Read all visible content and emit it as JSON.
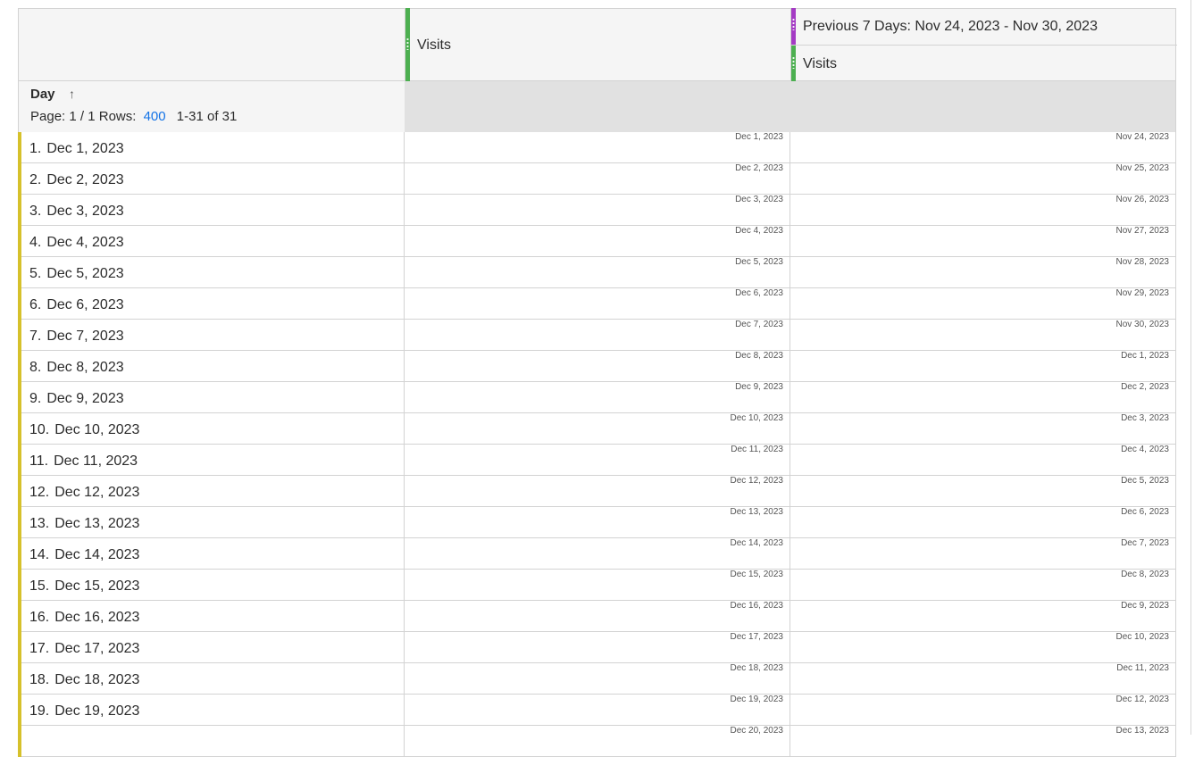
{
  "header": {
    "col1_metric": "Visits",
    "col2_segment": "Previous 7 Days: Nov 24, 2023 - Nov 30, 2023",
    "col2_metric": "Visits",
    "colors": {
      "visits_grip": "#4caf50",
      "segment_grip": "#a43bc4",
      "row_bar": "#d6c12b",
      "link": "#1473e6"
    }
  },
  "dimension": {
    "title": "Day",
    "sort_icon": "arrow-up-icon",
    "pager_label": "Page: 1 / 1",
    "rows_label": "Rows:",
    "rows_value": "400",
    "range_label": "1-31 of 31"
  },
  "rows": [
    {
      "num": "1.",
      "label": "Dec 1, 2023",
      "v1": "Dec 1, 2023",
      "v2": "Nov 24, 2023"
    },
    {
      "num": "2.",
      "label": "Dec 2, 2023",
      "v1": "Dec 2, 2023",
      "v2": "Nov 25, 2023"
    },
    {
      "num": "3.",
      "label": "Dec 3, 2023",
      "v1": "Dec 3, 2023",
      "v2": "Nov 26, 2023"
    },
    {
      "num": "4.",
      "label": "Dec 4, 2023",
      "v1": "Dec 4, 2023",
      "v2": "Nov 27, 2023"
    },
    {
      "num": "5.",
      "label": "Dec 5, 2023",
      "v1": "Dec 5, 2023",
      "v2": "Nov 28, 2023"
    },
    {
      "num": "6.",
      "label": "Dec 6, 2023",
      "v1": "Dec 6, 2023",
      "v2": "Nov 29, 2023"
    },
    {
      "num": "7.",
      "label": "Dec 7, 2023",
      "v1": "Dec 7, 2023",
      "v2": "Nov 30, 2023"
    },
    {
      "num": "8.",
      "label": "Dec 8, 2023",
      "v1": "Dec 8, 2023",
      "v2": "Dec 1, 2023"
    },
    {
      "num": "9.",
      "label": "Dec 9, 2023",
      "v1": "Dec 9, 2023",
      "v2": "Dec 2, 2023"
    },
    {
      "num": "10.",
      "label": "Dec 10, 2023",
      "v1": "Dec 10, 2023",
      "v2": "Dec 3, 2023"
    },
    {
      "num": "11.",
      "label": "Dec 11, 2023",
      "v1": "Dec 11, 2023",
      "v2": "Dec 4, 2023"
    },
    {
      "num": "12.",
      "label": "Dec 12, 2023",
      "v1": "Dec 12, 2023",
      "v2": "Dec 5, 2023"
    },
    {
      "num": "13.",
      "label": "Dec 13, 2023",
      "v1": "Dec 13, 2023",
      "v2": "Dec 6, 2023"
    },
    {
      "num": "14.",
      "label": "Dec 14, 2023",
      "v1": "Dec 14, 2023",
      "v2": "Dec 7, 2023"
    },
    {
      "num": "15.",
      "label": "Dec 15, 2023",
      "v1": "Dec 15, 2023",
      "v2": "Dec 8, 2023"
    },
    {
      "num": "16.",
      "label": "Dec 16, 2023",
      "v1": "Dec 16, 2023",
      "v2": "Dec 9, 2023"
    },
    {
      "num": "17.",
      "label": "Dec 17, 2023",
      "v1": "Dec 17, 2023",
      "v2": "Dec 10, 2023"
    },
    {
      "num": "18.",
      "label": "Dec 18, 2023",
      "v1": "Dec 18, 2023",
      "v2": "Dec 11, 2023"
    },
    {
      "num": "19.",
      "label": "Dec 19, 2023",
      "v1": "Dec 19, 2023",
      "v2": "Dec 12, 2023"
    },
    {
      "num": "",
      "label": "",
      "v1": "Dec 20, 2023",
      "v2": "Dec 13, 2023"
    }
  ]
}
